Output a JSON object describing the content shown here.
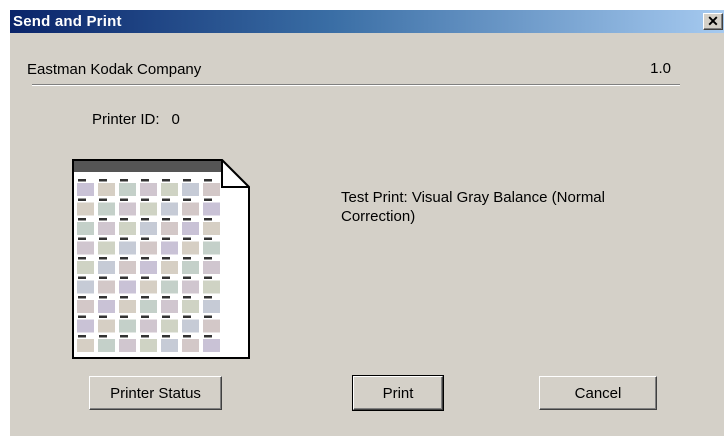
{
  "window": {
    "title": "Send and Print",
    "close_icon": "close-icon"
  },
  "header": {
    "company": "Eastman Kodak Company",
    "version": "1.0"
  },
  "printer": {
    "label": "Printer ID:",
    "value": "0"
  },
  "test_print": {
    "text": "Test Print: Visual Gray Balance (Normal Correction)",
    "thumbnail_icon": "test-print-thumbnail"
  },
  "buttons": {
    "status": "Printer Status",
    "print": "Print",
    "cancel": "Cancel"
  },
  "colors": {
    "title_start": "#0a246a",
    "title_end": "#a6caf0",
    "dialog_bg": "#d4d0c8"
  }
}
